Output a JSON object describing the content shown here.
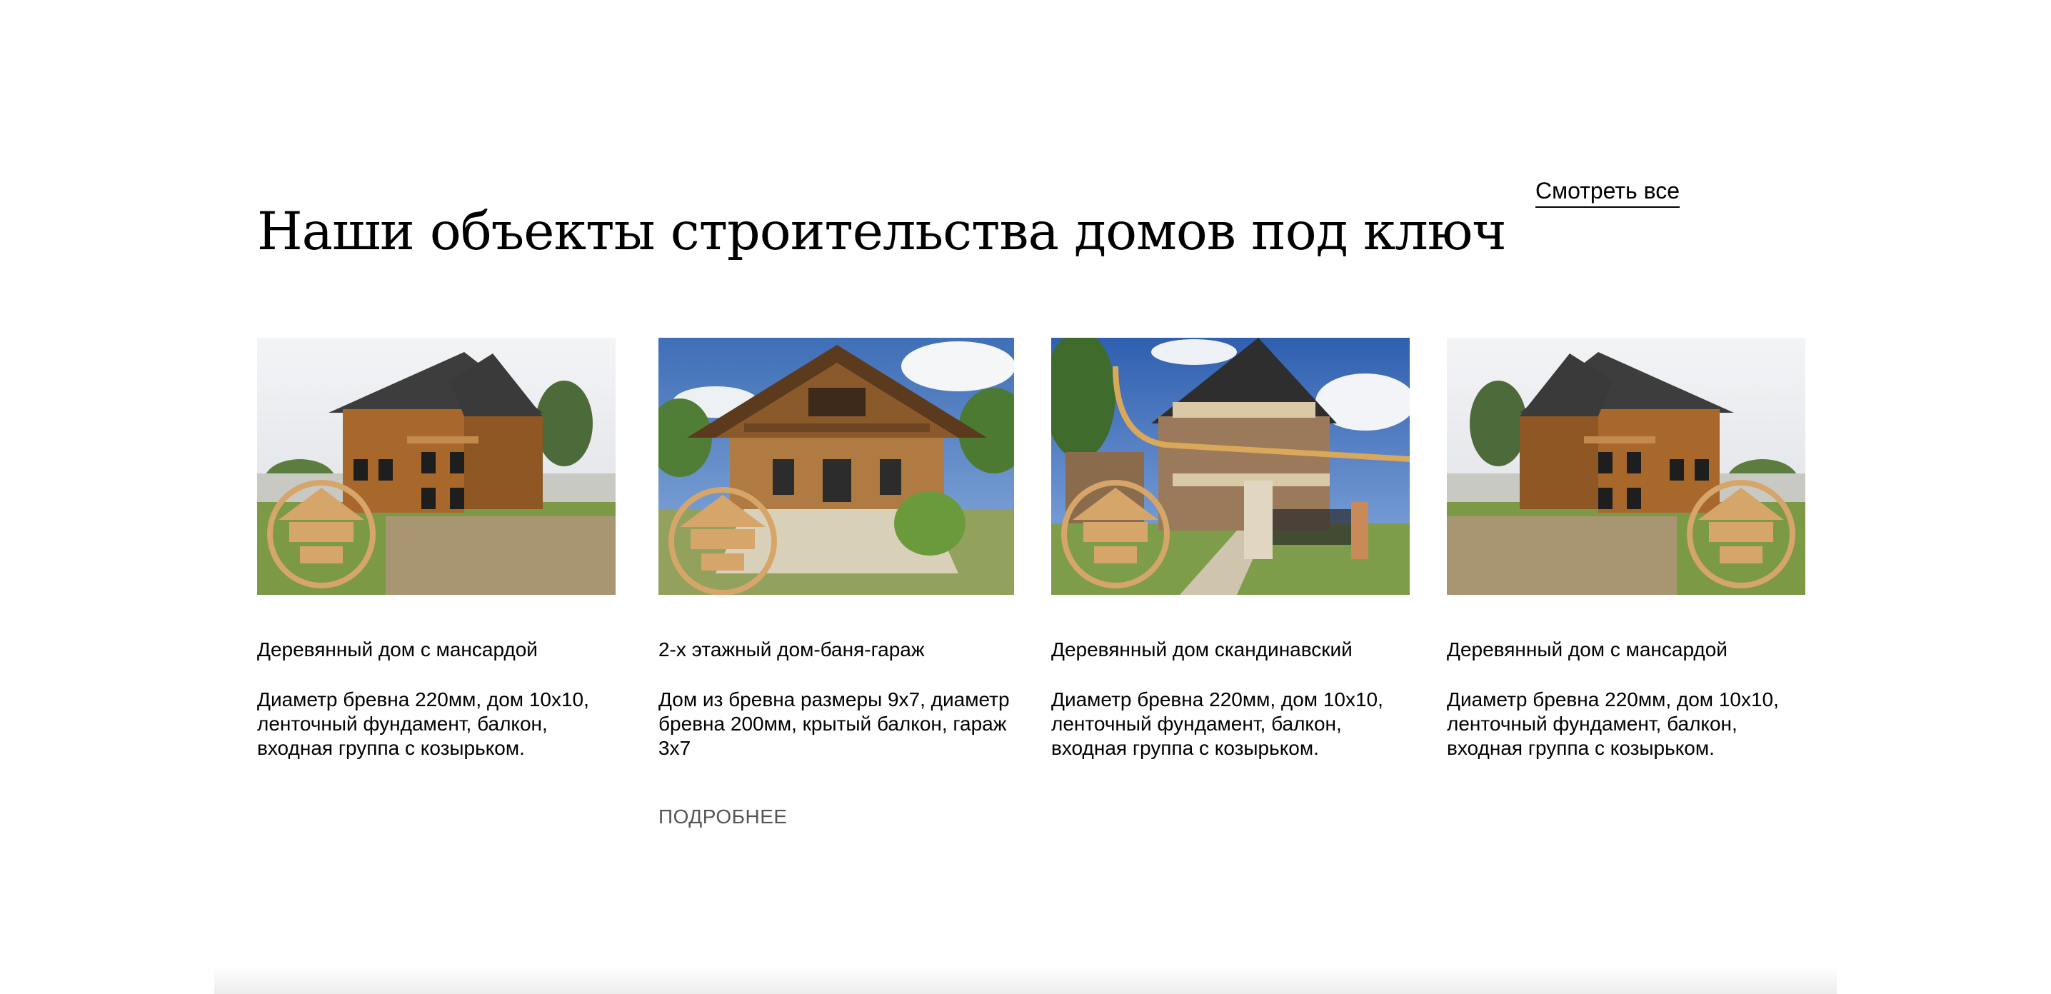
{
  "section": {
    "title": "Наши объекты строительства домов под ключ",
    "view_all_label": "Смотреть все"
  },
  "cards": [
    {
      "title": "Деревянный дом с мансардой",
      "description": "Диаметр бревна 220мм, дом 10х10, ленточный фундамент, балкон, входная группа с козырьком.",
      "more_label": ""
    },
    {
      "title": "2-х этажный дом-баня-гараж",
      "description": "Дом из бревна размеры 9х7, диаметр бревна 200мм, крытый балкон, гараж 3х7",
      "more_label": "ПОДРОБНЕЕ"
    },
    {
      "title": "Деревянный дом скандинавский",
      "description": "Диаметр бревна 220мм, дом 10х10, ленточный фундамент, балкон, входная группа с козырьком.",
      "more_label": ""
    },
    {
      "title": "Деревянный дом с мансардой",
      "description": "Диаметр бревна 220мм, дом 10х10, ленточный фундамент, балкон, входная группа с козырьком.",
      "more_label": ""
    }
  ],
  "colors": {
    "text": "#000000",
    "more_link": "#555555",
    "wood": "#a0642a",
    "roof": "#3b3b3b",
    "grass": "#6a8f3a",
    "sky_cloudy": "#e6e9ee",
    "sky_blue": "#4f7fc6",
    "logo_gold": "#d6a56a"
  },
  "icons": {
    "watermark": "company-logo-watermark"
  }
}
